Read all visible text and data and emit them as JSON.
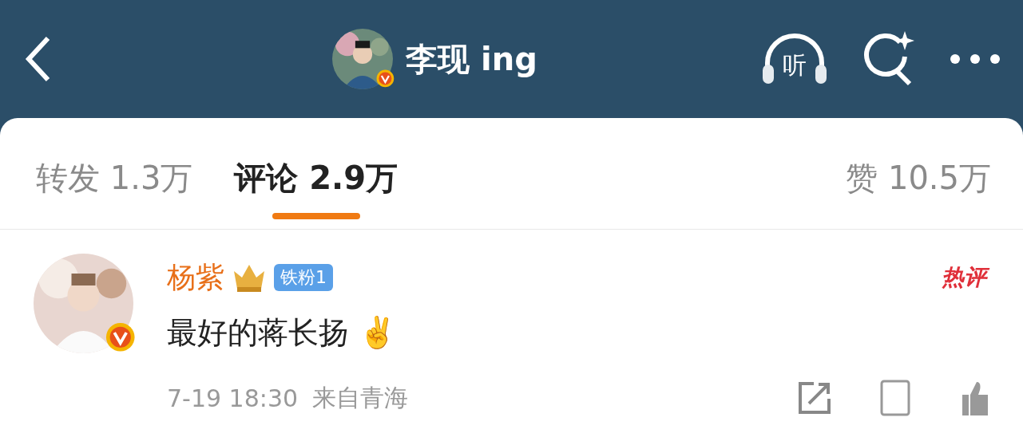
{
  "header": {
    "title": "李现 ing",
    "verified": true,
    "listen_icon_text": "听"
  },
  "tabs": [
    {
      "label": "转发 1.3万",
      "selected": false
    },
    {
      "label": "评论 2.9万",
      "selected": true
    },
    {
      "label": "赞 10.5万",
      "selected": false
    }
  ],
  "comments": [
    {
      "author": "杨紫",
      "verified": true,
      "fan_badge": "铁粉1",
      "tag": "热评",
      "text": "最好的蒋长扬 ✌️",
      "time": "7-19 18:30",
      "location": "来自青海"
    }
  ]
}
